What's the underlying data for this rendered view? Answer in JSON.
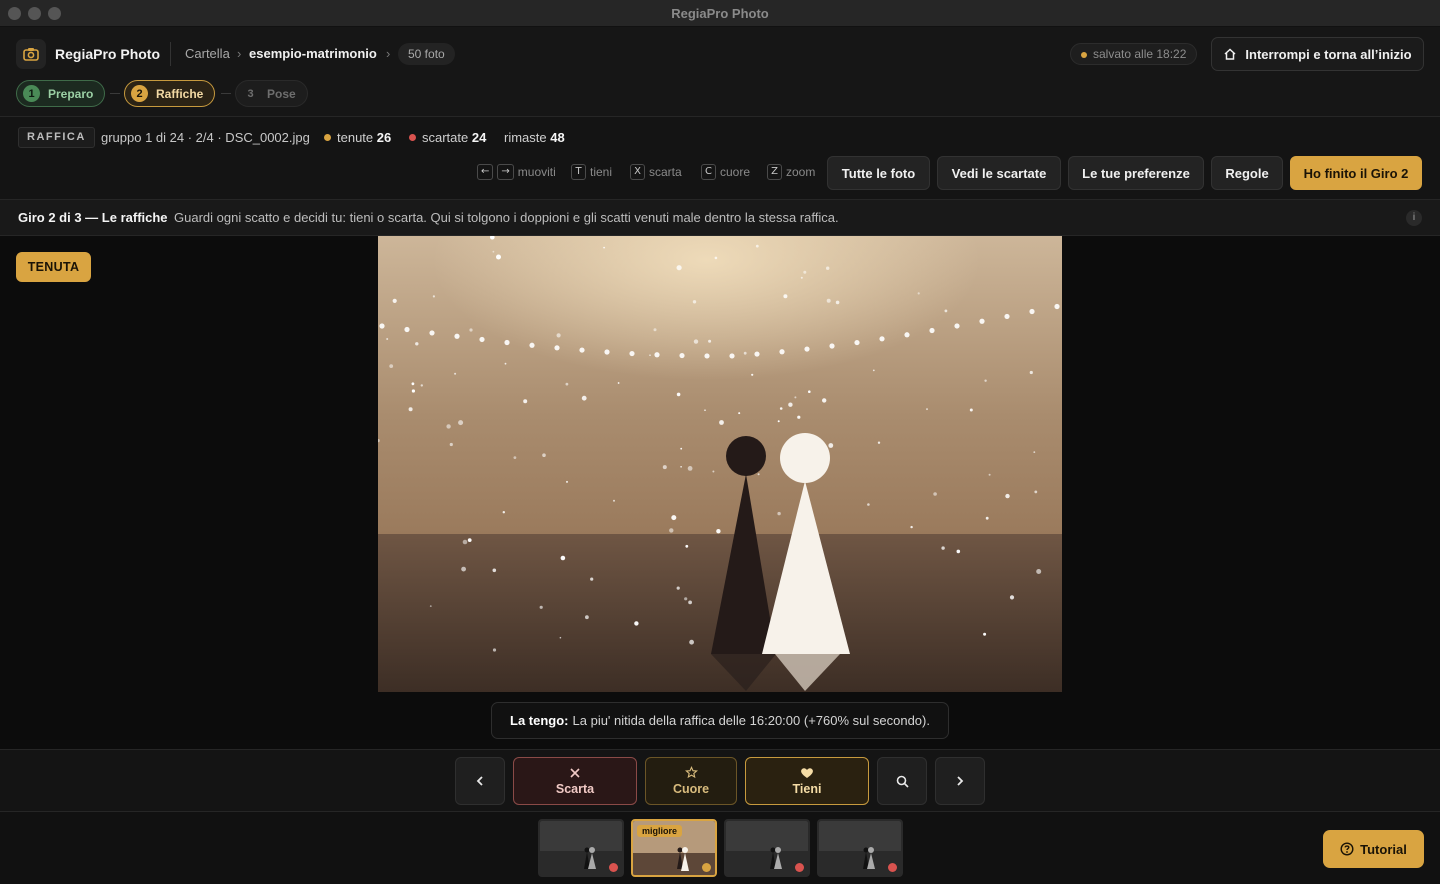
{
  "window": {
    "title": "RegiaPro Photo"
  },
  "header": {
    "app_name": "RegiaPro Photo",
    "breadcrumb": {
      "root": "Cartella",
      "separator": "›",
      "folder": "esempio-matrimonio"
    },
    "photo_count": "50 foto",
    "saved_status": "salvato alle 18:22",
    "stop_button": "Interrompi e torna all’inizio"
  },
  "steps": [
    {
      "num": "1",
      "label": "Preparo",
      "state": "done"
    },
    {
      "num": "2",
      "label": "Raffiche",
      "state": "active"
    },
    {
      "num": "3",
      "label": "Pose",
      "state": "pending"
    }
  ],
  "toolbar": {
    "burst_tag": "RAFFICA",
    "burst_info": "gruppo 1 di 24 · 2/4 · DSC_0002.jpg",
    "kept_label": "tenute",
    "kept_count": "26",
    "discarded_label": "scartate",
    "discarded_count": "24",
    "remaining_label": "rimaste",
    "remaining_count": "48",
    "hints": {
      "move_keys": [
        "←",
        "→"
      ],
      "move": "muoviti",
      "keep_key": "T",
      "keep": "tieni",
      "discard_key": "X",
      "discard": "scarta",
      "heart_key": "C",
      "heart": "cuore",
      "zoom_key": "Z",
      "zoom": "zoom"
    },
    "buttons": {
      "all_photos": "Tutte le foto",
      "view_discarded": "Vedi le scartate",
      "preferences": "Le tue preferenze",
      "rules": "Regole",
      "finish": "Ho finito il Giro 2"
    }
  },
  "banner": {
    "title": "Giro 2 di 3 — Le raffiche",
    "text": "Guardi ogni scatto e decidi tu: tieni o scarta. Qui si tolgono i doppioni e gli scatti venuti male dentro la stessa raffica.",
    "info_icon": "i"
  },
  "viewer": {
    "status_badge": "TENUTA",
    "caption_bold": "La tengo:",
    "caption_text": "La piu' nitida della raffica delle 16:20:00 (+760% sul secondo)."
  },
  "actions": {
    "prev_icon": "chevron-left-icon",
    "discard": "Scarta",
    "heart": "Cuore",
    "keep": "Tieni",
    "zoom_icon": "search-icon",
    "next_icon": "chevron-right-icon"
  },
  "filmstrip": {
    "best_tag": "migliore",
    "thumbs": [
      {
        "status": "discarded",
        "color": "#d9534f"
      },
      {
        "status": "kept",
        "color": "#d9a441",
        "selected": true
      },
      {
        "status": "discarded",
        "color": "#d9534f"
      },
      {
        "status": "discarded",
        "color": "#d9534f"
      }
    ]
  },
  "tutorial": "Tutorial",
  "colors": {
    "accent": "#d9a441",
    "discard": "#d9534f",
    "success": "#4a8a57",
    "background": "#0d0d0d"
  }
}
